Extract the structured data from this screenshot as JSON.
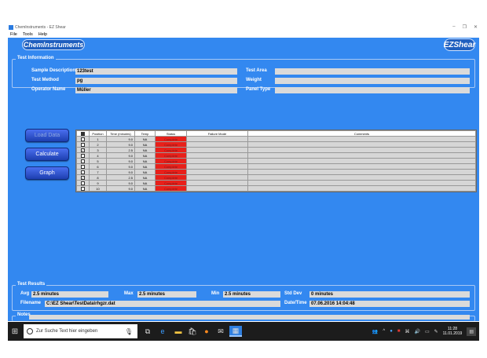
{
  "window": {
    "title": "Chemlnstruments - EZ Shear",
    "controls": [
      "–",
      "❐",
      "✕"
    ]
  },
  "menu": [
    "File",
    "Tools",
    "Help"
  ],
  "logos": {
    "left": "Chemlnstruments",
    "right": "EZShear"
  },
  "test_information": {
    "title": "Test Information",
    "sample_description": {
      "label": "Sample Description",
      "value": "123test"
    },
    "test_method": {
      "label": "Test Method",
      "value": "pg"
    },
    "operator_name": {
      "label": "Operator Name",
      "value": "Müller"
    },
    "test_area": {
      "label": "Test Area",
      "value": ""
    },
    "weight": {
      "label": "Weight",
      "value": ""
    },
    "panel_type": {
      "label": "Panel Type",
      "value": ""
    }
  },
  "buttons": {
    "load_data": "Load Data",
    "calculate": "Calculate",
    "graph": "Graph"
  },
  "grid": {
    "headers": [
      "Position",
      "Time (minutes)",
      "Temp",
      "Status",
      "Failure Mode",
      "Comments"
    ],
    "rows": [
      {
        "checked": false,
        "position": "1",
        "time": "9.0",
        "temp": "NA",
        "status": "Complete"
      },
      {
        "checked": false,
        "position": "2",
        "time": "9.0",
        "temp": "NA",
        "status": "Complete"
      },
      {
        "checked": true,
        "position": "3",
        "time": "2.5",
        "temp": "NA",
        "status": "Complete"
      },
      {
        "checked": false,
        "position": "4",
        "time": "9.0",
        "temp": "NA",
        "status": "Complete"
      },
      {
        "checked": false,
        "position": "5",
        "time": "9.0",
        "temp": "NA",
        "status": "Complete"
      },
      {
        "checked": false,
        "position": "6",
        "time": "9.0",
        "temp": "NA",
        "status": "Complete"
      },
      {
        "checked": false,
        "position": "7",
        "time": "9.0",
        "temp": "NA",
        "status": "Complete"
      },
      {
        "checked": true,
        "position": "8",
        "time": "2.5",
        "temp": "NA",
        "status": "Complete"
      },
      {
        "checked": false,
        "position": "9",
        "time": "9.0",
        "temp": "NA",
        "status": "Complete"
      },
      {
        "checked": false,
        "position": "10",
        "time": "9.0",
        "temp": "NA",
        "status": "Complete"
      }
    ]
  },
  "test_results": {
    "title": "Test Results",
    "avg": {
      "label": "Avg",
      "value": "2.5 minutes"
    },
    "max": {
      "label": "Max",
      "value": "2.5 minutes"
    },
    "min": {
      "label": "Min",
      "value": "2.5 minutes"
    },
    "std_dev": {
      "label": "Std Dev",
      "value": "0 minutes"
    },
    "filename": {
      "label": "Filename",
      "value": "C:\\EZ Shear\\TestData\\rhgzr.dat"
    },
    "datetime": {
      "label": "Date/Time",
      "value": "07.06.2016 14:04:48"
    }
  },
  "notes": {
    "title": "Notes",
    "value": ""
  },
  "taskbar": {
    "search_placeholder": "Zur Suche Text hier eingeben",
    "clock_time": "11:28",
    "clock_date": "11.01.2019"
  },
  "colors": {
    "app_bg": "#3388f0",
    "status_complete": "#e8201a",
    "taskbar": "#1c1c1c"
  }
}
